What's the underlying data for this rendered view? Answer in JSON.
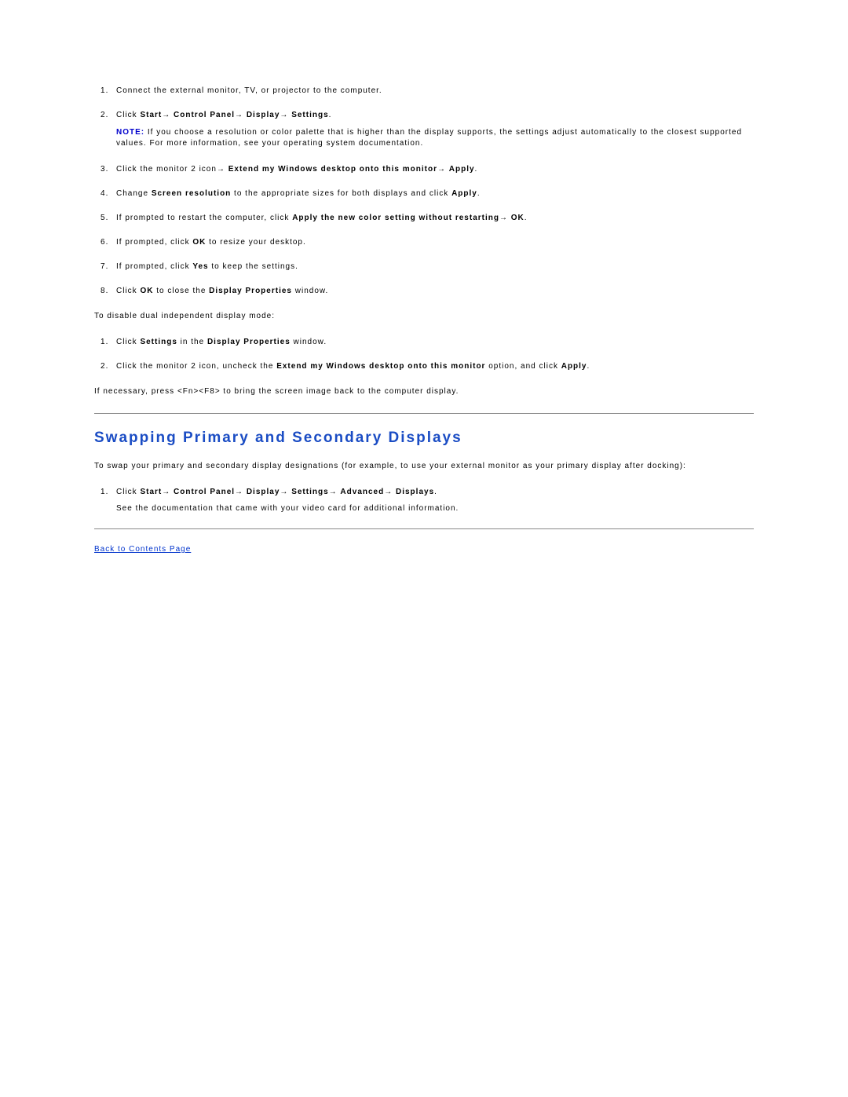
{
  "steps_a": [
    {
      "t1": "Connect the external monitor, TV, or projector to the computer."
    },
    {
      "t1": "Click ",
      "b1": "Start",
      "arrow1": "→",
      "b2": "Control Panel",
      "arrow2": "→",
      "b3": "Display",
      "arrow3": "→",
      "b4": "Settings",
      "t2": ".",
      "note_label": "NOTE: ",
      "note_body": "If you choose a resolution or color palette that is higher than the display supports, the settings adjust automatically to the closest supported values. For more information, see your operating system documentation."
    },
    {
      "t1": "Click the monitor 2 icon",
      "arrow1": "→",
      "b1": "Extend my Windows desktop onto this monitor",
      "arrow2": "→",
      "b2": "Apply",
      "t2": "."
    },
    {
      "t1": "Change ",
      "b1": "Screen resolution",
      "t2": " to the appropriate sizes for both displays and click ",
      "b2": "Apply",
      "t3": "."
    },
    {
      "t1": "If prompted to restart the computer, click ",
      "b1": "Apply the new color setting without restarting",
      "arrow1": "→",
      "b2": "OK",
      "t2": "."
    },
    {
      "t1": "If prompted, click ",
      "b1": "OK",
      "t2": " to resize your desktop."
    },
    {
      "t1": "If prompted, click ",
      "b1": "Yes",
      "t2": " to keep the settings."
    },
    {
      "t1": "Click ",
      "b1": "OK",
      "t2": " to close the ",
      "b2": "Display Properties",
      "t3": " window."
    }
  ],
  "disable_intro": "To disable dual independent display mode:",
  "steps_b": [
    {
      "t1": "Click ",
      "b1": "Settings",
      "t2": " in the ",
      "b2": "Display Properties",
      "t3": " window."
    },
    {
      "t1": "Click the monitor 2 icon, uncheck the ",
      "b1": "Extend my Windows desktop onto this monitor",
      "t2": " option, and click ",
      "b2": "Apply",
      "t3": "."
    }
  ],
  "fn_text": "If necessary, press <Fn><F8> to bring the screen image back to the computer display.",
  "heading": "Swapping Primary and Secondary Displays",
  "swap_intro": "To swap your primary and secondary display designations (for example, to use your external monitor as your primary display after docking):",
  "steps_c": [
    {
      "t1": "Click ",
      "b1": "Start",
      "arrow1": "→",
      "b2": "Control Panel",
      "arrow2": "→",
      "b3": "Display",
      "arrow3": "→",
      "b4": "Settings",
      "arrow4": "→",
      "b5": "Advanced",
      "arrow5": "→",
      "b6": "Displays",
      "t2": ".",
      "sub": "See the documentation that came with your video card for additional information."
    }
  ],
  "back_link": "Back to Contents Page"
}
